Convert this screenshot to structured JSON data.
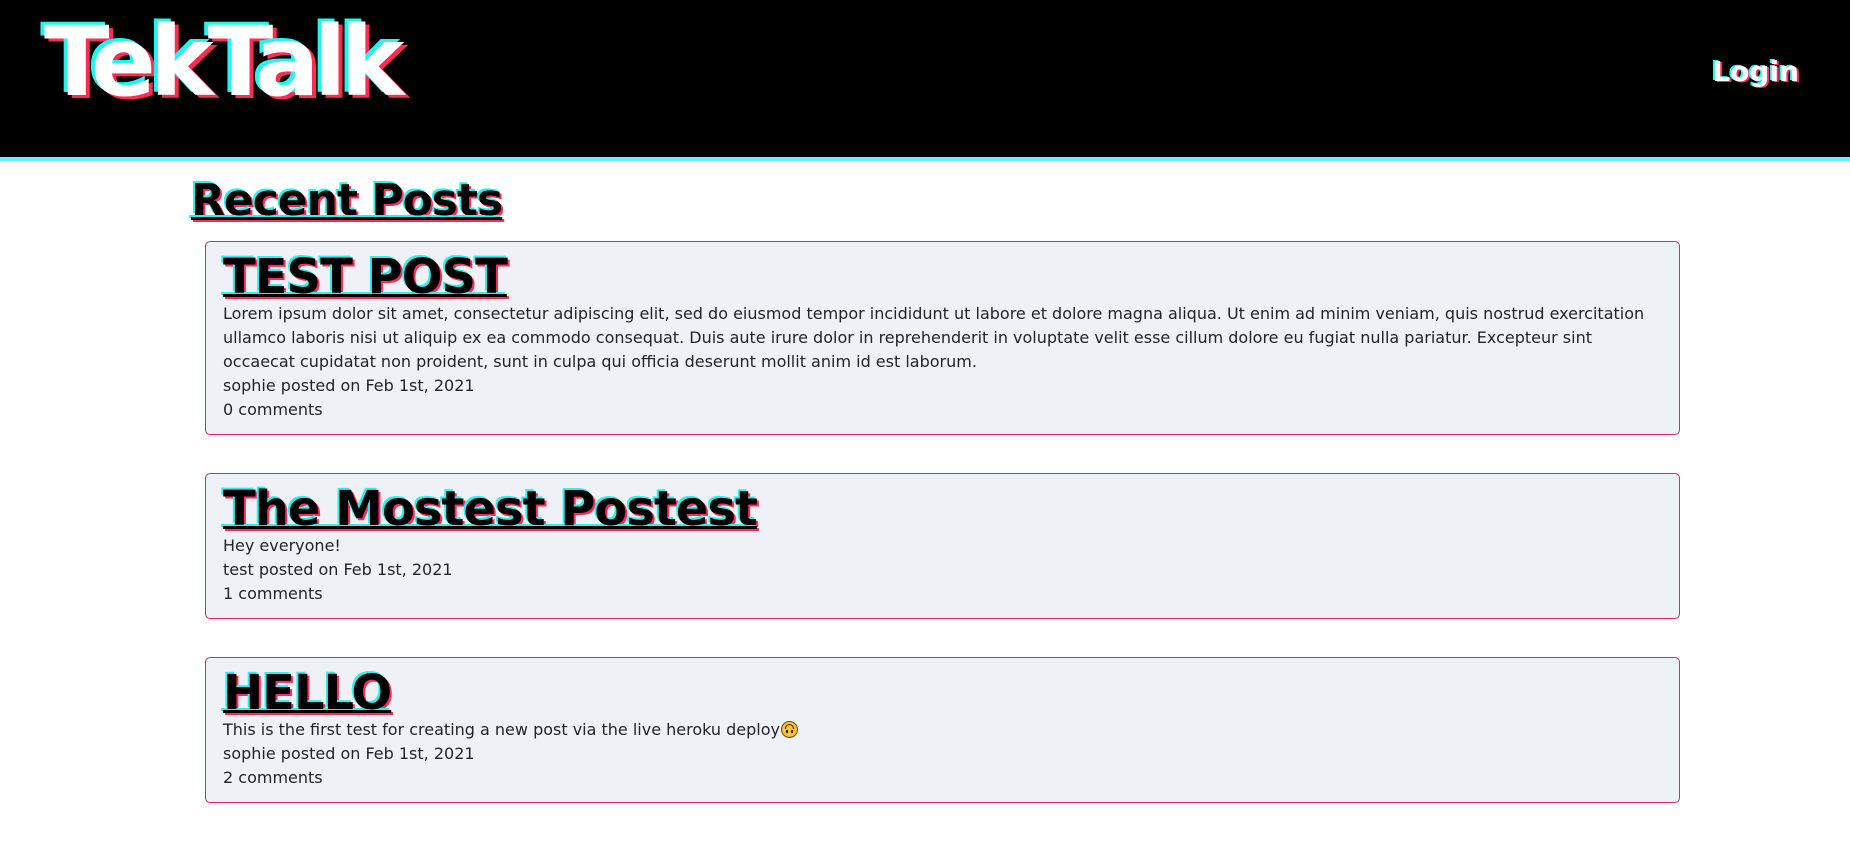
{
  "header": {
    "brand": "TekTalk",
    "login_label": "Login"
  },
  "main": {
    "title": "Recent Posts",
    "posts": [
      {
        "title": "TEST POST",
        "body": "Lorem ipsum dolor sit amet, consectetur adipiscing elit, sed do eiusmod tempor incididunt ut labore et dolore magna aliqua. Ut enim ad minim veniam, quis nostrud exercitation ullamco laboris nisi ut aliquip ex ea commodo consequat. Duis aute irure dolor in reprehenderit in voluptate velit esse cillum dolore eu fugiat nulla pariatur. Excepteur sint occaecat cupidatat non proident, sunt in culpa qui officia deserunt mollit anim id est laborum.",
        "meta": "sophie posted on Feb 1st, 2021",
        "comments": "0 comments"
      },
      {
        "title": "The Mostest Postest",
        "body": "Hey everyone!",
        "meta": "test posted on Feb 1st, 2021",
        "comments": "1 comments"
      },
      {
        "title": "HELLO",
        "body": "This is the first test for creating a new post via the live heroku deploy",
        "body_emoji": "upside-down-face-emoji",
        "meta": "sophie posted on Feb 1st, 2021",
        "comments": "2 comments"
      }
    ]
  },
  "colors": {
    "header_bg": "#000000",
    "header_border": "#69f0f0",
    "accent_cyan": "#25f4ee",
    "accent_pink": "#fe2c55",
    "card_bg": "#eef1f5",
    "card_border": "#e8246b"
  }
}
